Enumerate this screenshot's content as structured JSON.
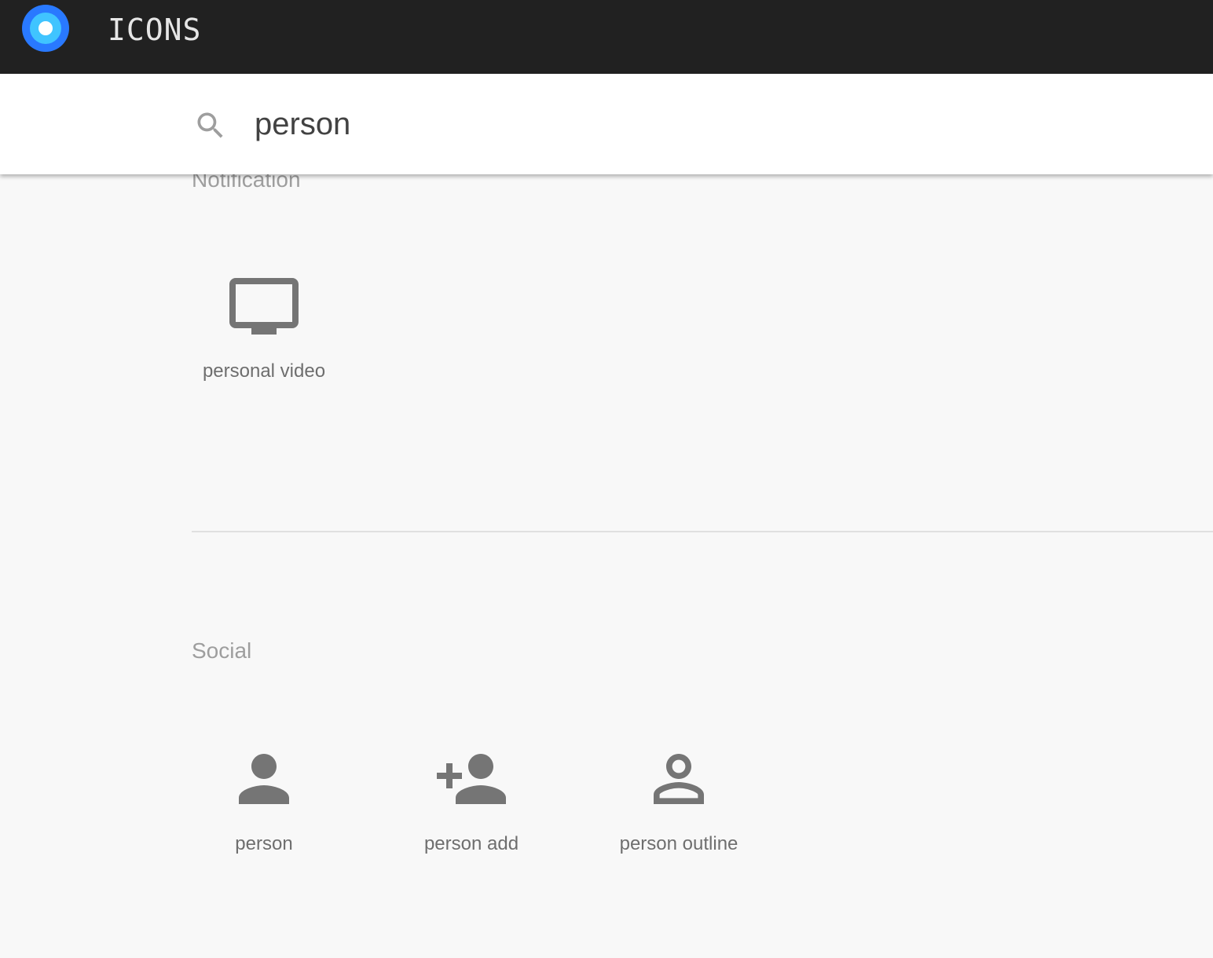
{
  "header": {
    "app_title": "ICONS",
    "logo_icon": "target-circle-logo",
    "accent_color": "#2979ff",
    "background_color": "#212121"
  },
  "search": {
    "icon": "search-icon",
    "value": "person",
    "placeholder": ""
  },
  "sections": [
    {
      "title": "Notification",
      "icons": [
        {
          "label": "personal video",
          "icon": "personal-video-icon"
        }
      ]
    },
    {
      "title": "Social",
      "icons": [
        {
          "label": "person",
          "icon": "person-icon"
        },
        {
          "label": "person add",
          "icon": "person-add-icon"
        },
        {
          "label": "person outline",
          "icon": "person-outline-icon"
        }
      ]
    }
  ],
  "colors": {
    "icon": "#757575",
    "section_heading": "#9e9e9e",
    "page_background": "#f8f8f8"
  }
}
